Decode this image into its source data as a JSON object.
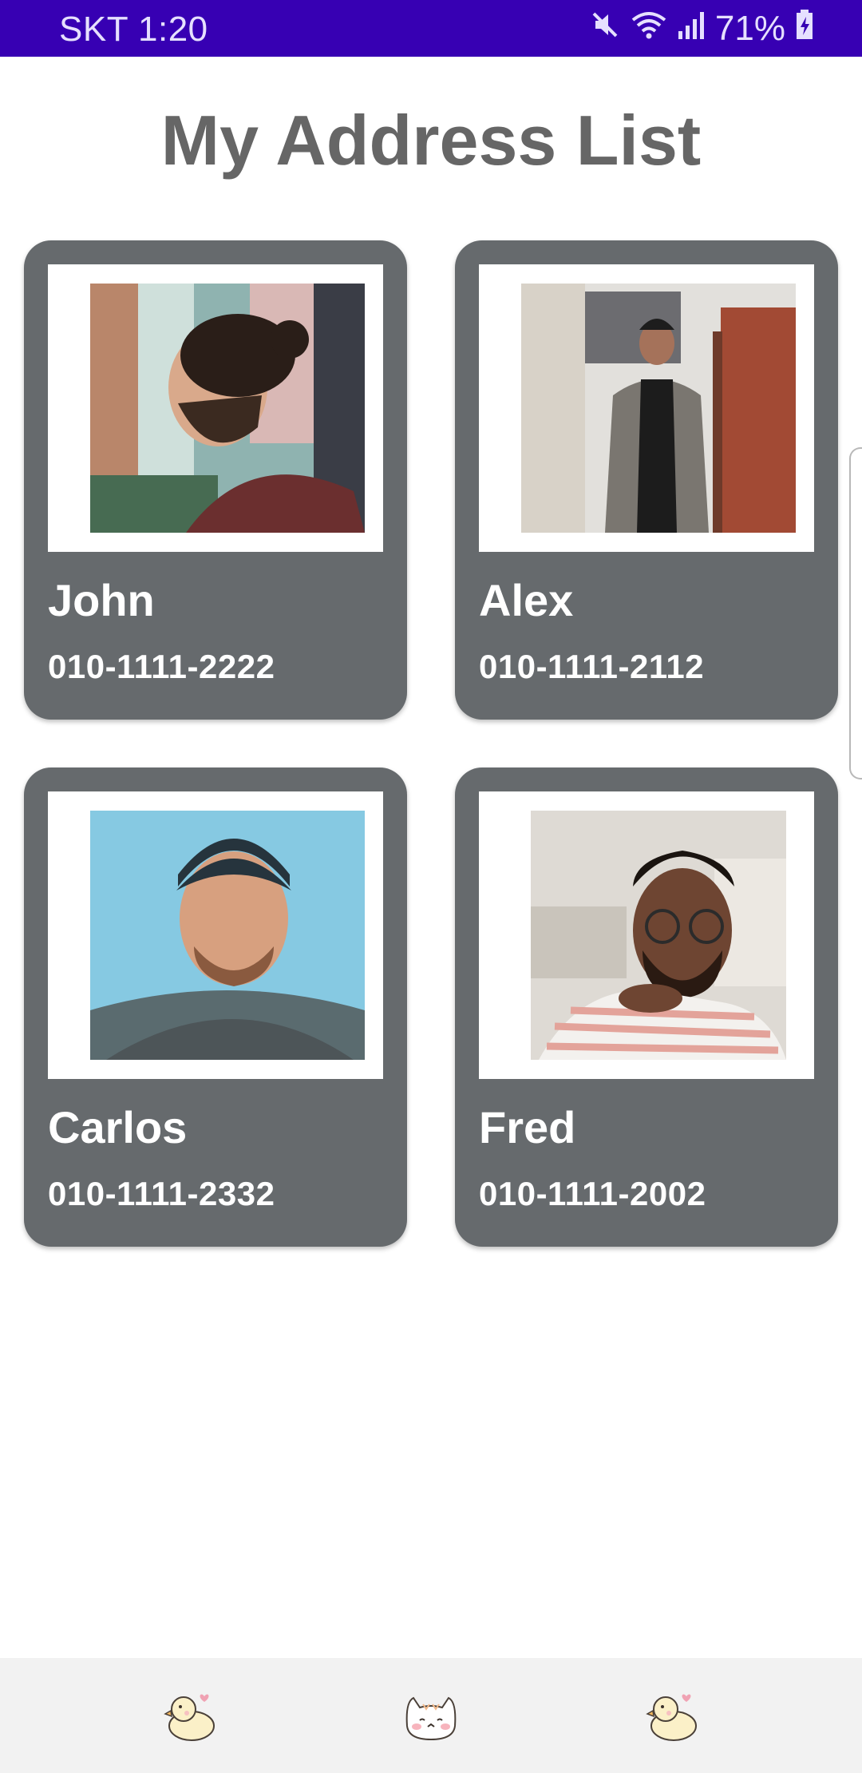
{
  "status_bar": {
    "carrier_time": "SKT 1:20",
    "battery": "71%",
    "icons": [
      "mute-icon",
      "wifi-icon",
      "signal-icon",
      "battery-icon"
    ]
  },
  "page": {
    "title": "My Address List"
  },
  "contacts": [
    {
      "name": "John",
      "phone": "010-1111-2222"
    },
    {
      "name": "Alex",
      "phone": "010-1111-2112"
    },
    {
      "name": "Carlos",
      "phone": "010-1111-2332"
    },
    {
      "name": "Fred",
      "phone": "010-1111-2002"
    }
  ],
  "bottom_nav": {
    "items": [
      {
        "icon": "duck-icon"
      },
      {
        "icon": "cat-icon"
      },
      {
        "icon": "duck-icon"
      }
    ]
  },
  "colors": {
    "status_bar": "#3700b3",
    "card": "#666a6d",
    "title": "#666666",
    "nav_background": "#f2f2f2"
  }
}
